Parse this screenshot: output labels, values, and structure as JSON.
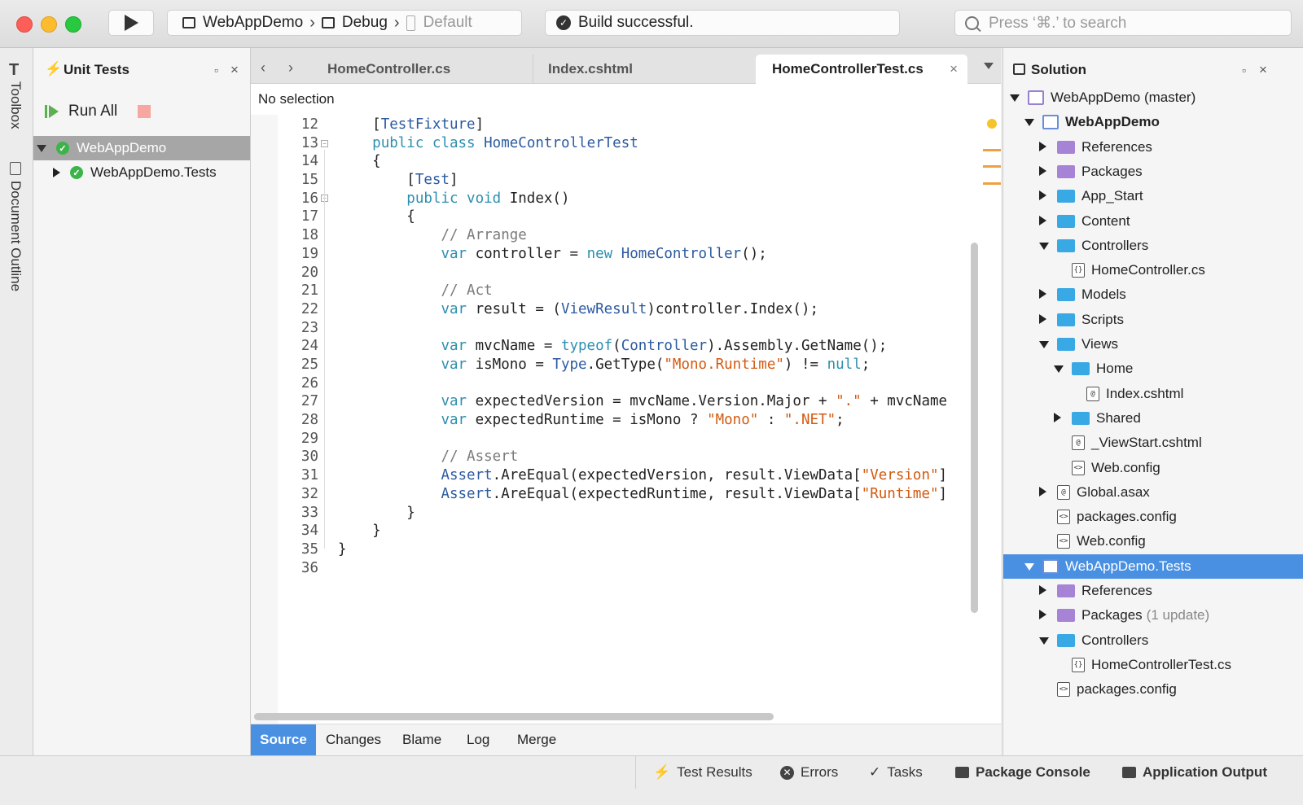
{
  "toolbar": {
    "project": "WebAppDemo",
    "config": "Debug",
    "target": "Default",
    "build_status": "Build successful.",
    "search_placeholder": "Press ‘⌘.’ to search"
  },
  "left_strip": {
    "toolbox": "Toolbox",
    "outline": "Document Outline"
  },
  "unit_tests": {
    "title": "Unit Tests",
    "run_all": "Run All",
    "items": [
      {
        "label": "WebAppDemo",
        "expanded": true,
        "selected": true
      },
      {
        "label": "WebAppDemo.Tests",
        "expanded": false
      }
    ]
  },
  "editor": {
    "tabs": [
      {
        "label": "HomeController.cs"
      },
      {
        "label": "Index.cshtml"
      },
      {
        "label": "HomeControllerTest.cs",
        "active": true
      }
    ],
    "breadcrumb": "No selection",
    "line_numbers": [
      "12",
      "13",
      "14",
      "15",
      "16",
      "17",
      "18",
      "19",
      "20",
      "21",
      "22",
      "23",
      "24",
      "25",
      "26",
      "27",
      "28",
      "29",
      "30",
      "31",
      "32",
      "33",
      "34",
      "35",
      "36"
    ],
    "bottom_tabs": [
      "Source",
      "Changes",
      "Blame",
      "Log",
      "Merge"
    ]
  },
  "solution": {
    "title": "Solution",
    "items": [
      {
        "label": "WebAppDemo (master)"
      },
      {
        "label": "WebAppDemo"
      },
      {
        "label": "References"
      },
      {
        "label": "Packages"
      },
      {
        "label": "App_Start"
      },
      {
        "label": "Content"
      },
      {
        "label": "Controllers"
      },
      {
        "label": "HomeController.cs"
      },
      {
        "label": "Models"
      },
      {
        "label": "Scripts"
      },
      {
        "label": "Views"
      },
      {
        "label": "Home"
      },
      {
        "label": "Index.cshtml"
      },
      {
        "label": "Shared"
      },
      {
        "label": "_ViewStart.cshtml"
      },
      {
        "label": "Web.config"
      },
      {
        "label": "Global.asax"
      },
      {
        "label": "packages.config"
      },
      {
        "label": "Web.config"
      },
      {
        "label": "WebAppDemo.Tests"
      },
      {
        "label": "References"
      },
      {
        "label": "Packages",
        "note": "(1 update)"
      },
      {
        "label": "Controllers"
      },
      {
        "label": "HomeControllerTest.cs"
      },
      {
        "label": "packages.config"
      }
    ]
  },
  "status_bar": {
    "test_results": "Test Results",
    "errors": "Errors",
    "tasks": "Tasks",
    "package_console": "Package Console",
    "application_output": "Application Output"
  },
  "colors": {
    "accent": "#4a90e2",
    "success": "#3cb44a",
    "folder": "#39a9e6"
  }
}
